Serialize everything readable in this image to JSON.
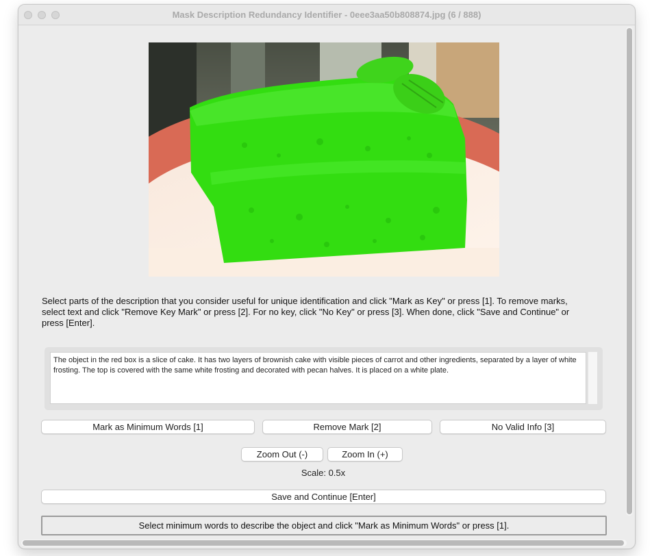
{
  "window": {
    "title": "Mask Description Redundancy Identifier - 0eee3aa50b808874.jpg (6 / 888)"
  },
  "image": {
    "subject": "slice of layered cake with green mask overlay",
    "mask_color": "#33dd11"
  },
  "instructions": "Select parts of the description that you consider useful for unique identification and click \"Mark as Key\" or press [1]. To remove marks, select text and click \"Remove Key Mark\" or press [2]. For no key, click \"No Key\" or press [3]. When done, click \"Save and Continue\" or press [Enter].",
  "description": "The object in the red box is a slice of cake. It has two layers of brownish cake with visible pieces of carrot and other ingredients, separated by a layer of white frosting. The top is covered with the same white frosting and decorated with pecan halves. It is placed on a white plate.",
  "buttons": {
    "mark_minimum": "Mark as Minimum Words [1]",
    "remove_mark": "Remove Mark [2]",
    "no_valid": "No Valid Info [3]",
    "zoom_out": "Zoom Out (-)",
    "zoom_in": "Zoom In (+)",
    "save_continue": "Save and Continue [Enter]"
  },
  "scale_text": "Scale: 0.5x",
  "status": "Select minimum words to describe the object and click \"Mark as Minimum Words\" or press [1]."
}
